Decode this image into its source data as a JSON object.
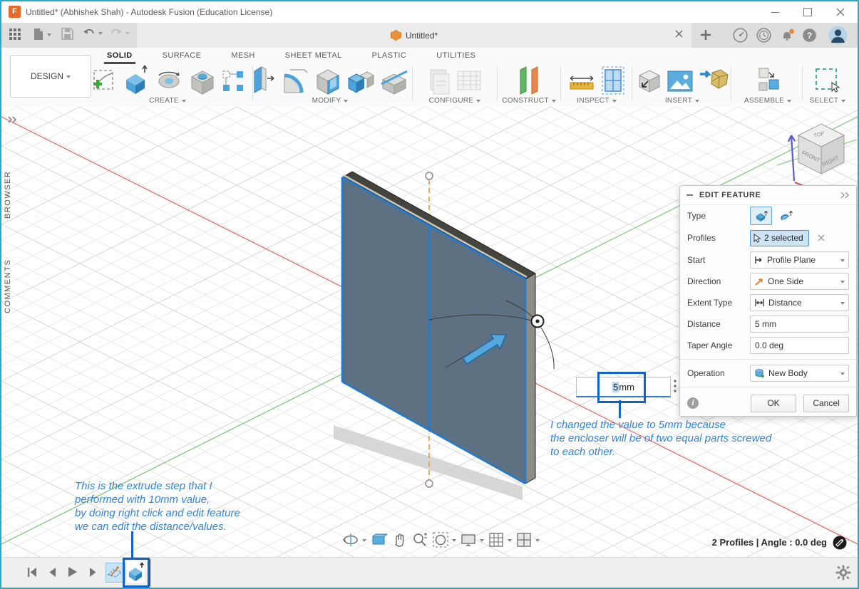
{
  "window": {
    "title": "Untitled* (Abhishek Shah) - Autodesk Fusion (Education License)",
    "logo_letter": "F"
  },
  "appbar": {
    "doc_tab_label": "Untitled*",
    "help_glyph": "?"
  },
  "ribbon": {
    "design_label": "DESIGN",
    "tabs": [
      {
        "label": "SOLID"
      },
      {
        "label": "SURFACE"
      },
      {
        "label": "MESH"
      },
      {
        "label": "SHEET METAL"
      },
      {
        "label": "PLASTIC"
      },
      {
        "label": "UTILITIES"
      }
    ],
    "groups": [
      {
        "label": "CREATE",
        "icons": [
          "create-sketch",
          "extrude",
          "revolve",
          "hole",
          "rectangular-pattern"
        ]
      },
      {
        "label": "MODIFY",
        "icons": [
          "press-pull",
          "fillet",
          "shell",
          "combine",
          "split-body"
        ]
      },
      {
        "label": "CONFIGURE",
        "icons": [
          "configuration",
          "configuration-table"
        ]
      },
      {
        "label": "CONSTRUCT",
        "icons": [
          "construction-plane"
        ]
      },
      {
        "label": "INSPECT",
        "icons": [
          "measure",
          "section-analysis"
        ]
      },
      {
        "label": "INSERT",
        "icons": [
          "derive",
          "canvas",
          "insert-mesh"
        ]
      },
      {
        "label": "ASSEMBLE",
        "icons": [
          "new-component"
        ]
      },
      {
        "label": "SELECT",
        "icons": [
          "select-box"
        ]
      }
    ]
  },
  "side_panel": {
    "browser_label": "BROWSER",
    "comments_label": "COMMENTS"
  },
  "viewcube": {
    "top": "TOP",
    "front": "FRONT",
    "right": "RIGHT"
  },
  "canvas": {
    "dim_label": "5.0",
    "value_field": {
      "selected": "5",
      "suffix": " mm"
    },
    "status_text": "2 Profiles | Angle : 0.0 deg",
    "annotation_value": {
      "line1": "I changed the value to 5mm because",
      "line2": "the encloser will be of two equal parts screwed",
      "line3": "to each other."
    },
    "annotation_step": {
      "line1": "This is the extrude step that I",
      "line2": "performed with 10mm value,",
      "line3": "by doing right click and edit feature",
      "line4": "we can edit the distance/values."
    }
  },
  "dialog": {
    "title": "EDIT FEATURE",
    "type_label": "Type",
    "profiles_label": "Profiles",
    "profiles_value": "2 selected",
    "start_label": "Start",
    "start_value": "Profile Plane",
    "direction_label": "Direction",
    "direction_value": "One Side",
    "extent_label": "Extent Type",
    "extent_value": "Distance",
    "distance_label": "Distance",
    "distance_value": "5 mm",
    "taper_label": "Taper Angle",
    "taper_value": "0.0 deg",
    "operation_label": "Operation",
    "operation_value": "New Body",
    "info_glyph": "i",
    "ok_label": "OK",
    "cancel_label": "Cancel"
  },
  "colors": {
    "selection_blue": "#1f7ad2",
    "annotation_blue": "#3585d6",
    "callout_blue": "#1262c9",
    "window_border": "#2aa9c4",
    "panel_face": "#5d7183",
    "construction_orange": "#e09a3c"
  }
}
